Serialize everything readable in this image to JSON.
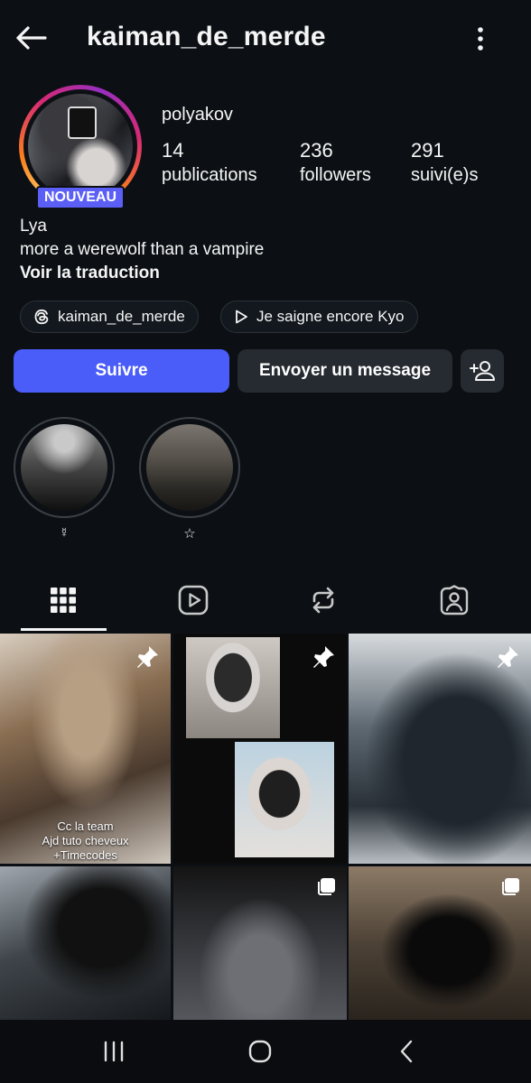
{
  "header": {
    "username": "kaiman_de_merde",
    "back_icon": "arrow-left-icon",
    "more_icon": "more-vertical-icon"
  },
  "profile": {
    "badge": "NOUVEAU",
    "display_name": "polyakov",
    "stats": [
      {
        "value": "14",
        "label": "publications"
      },
      {
        "value": "236",
        "label": "followers"
      },
      {
        "value": "291",
        "label": "suivi(e)s"
      }
    ],
    "bio_name": "Lya",
    "bio_text": "more a werewolf than a vampire",
    "translate_link": "Voir la traduction"
  },
  "links": {
    "threads": "kaiman_de_merde",
    "music": "Je saigne encore Kyo"
  },
  "actions": {
    "follow": "Suivre",
    "message": "Envoyer un message",
    "add_icon": "add-person-icon"
  },
  "highlights": [
    {
      "label": "☿"
    },
    {
      "label": "☆"
    }
  ],
  "tabs": [
    "grid-icon",
    "reels-icon",
    "reposts-icon",
    "tagged-icon"
  ],
  "posts": [
    {
      "pinned": true,
      "caption": [
        "Cc la team",
        "Ajd tuto cheveux",
        "+Timecodes"
      ]
    },
    {
      "pinned": true
    },
    {
      "pinned": true
    },
    {
      "multi": true
    },
    {
      "multi": true
    },
    {
      "multi": true
    }
  ],
  "colors": {
    "background": "#0c1014",
    "follow_button": "#4a5df9",
    "secondary_button": "#262b31",
    "badge": "#5b5ff6"
  }
}
